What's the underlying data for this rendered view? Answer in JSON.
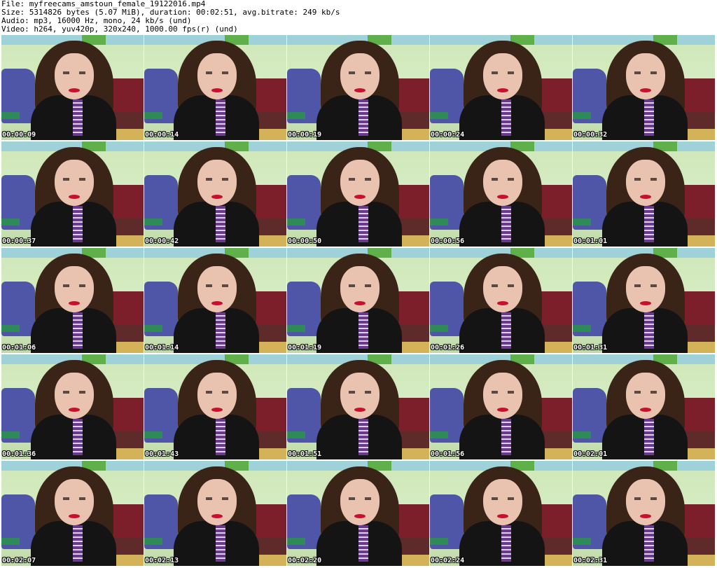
{
  "header": {
    "file_line": "File: myfreecams_amstoun_female_19122016.mp4",
    "size_line": "Size: 5314826 bytes (5.07 MiB), duration: 00:02:51, avg.bitrate: 249 kb/s",
    "audio_line": "Audio: mp3, 16000 Hz, mono, 24 kb/s (und)",
    "video_line": "Video: h264, yuv420p, 320x240, 1000.00 fps(r) (und)"
  },
  "thumbnails": [
    {
      "timestamp": "00:00:09"
    },
    {
      "timestamp": "00:00:14"
    },
    {
      "timestamp": "00:00:19"
    },
    {
      "timestamp": "00:00:24"
    },
    {
      "timestamp": "00:00:32"
    },
    {
      "timestamp": "00:00:37"
    },
    {
      "timestamp": "00:00:42"
    },
    {
      "timestamp": "00:00:50"
    },
    {
      "timestamp": "00:00:56"
    },
    {
      "timestamp": "00:01:01"
    },
    {
      "timestamp": "00:01:06"
    },
    {
      "timestamp": "00:01:14"
    },
    {
      "timestamp": "00:01:19"
    },
    {
      "timestamp": "00:01:26"
    },
    {
      "timestamp": "00:01:31"
    },
    {
      "timestamp": "00:01:36"
    },
    {
      "timestamp": "00:01:43"
    },
    {
      "timestamp": "00:01:51"
    },
    {
      "timestamp": "00:01:56"
    },
    {
      "timestamp": "00:02:01"
    },
    {
      "timestamp": "00:02:07"
    },
    {
      "timestamp": "00:02:13"
    },
    {
      "timestamp": "00:02:20"
    },
    {
      "timestamp": "00:02:24"
    },
    {
      "timestamp": "00:02:31"
    }
  ]
}
